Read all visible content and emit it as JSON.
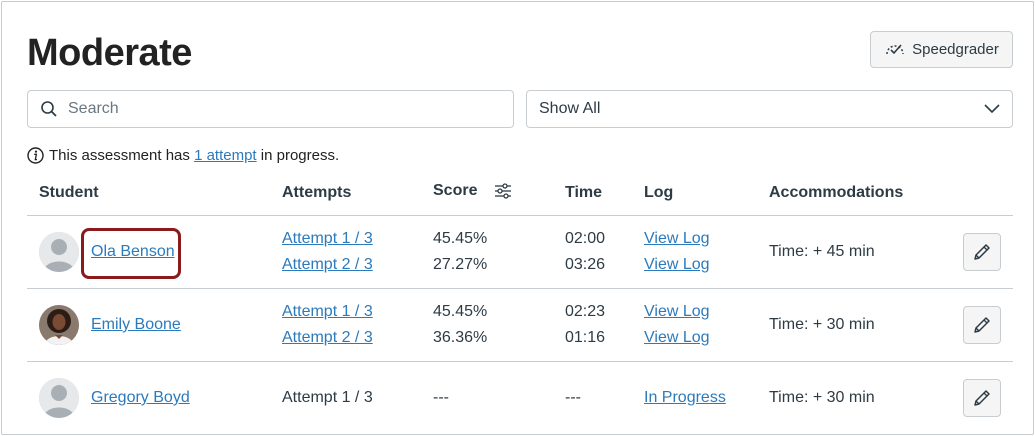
{
  "page": {
    "title": "Moderate",
    "speedgrader_label": "Speedgrader"
  },
  "search": {
    "placeholder": "Search",
    "value": ""
  },
  "filter": {
    "selected": "Show All"
  },
  "notice": {
    "prefix": "This assessment has",
    "link": "1 attempt",
    "suffix": "in progress."
  },
  "table": {
    "headers": {
      "student": "Student",
      "attempts": "Attempts",
      "score": "Score",
      "time": "Time",
      "log": "Log",
      "accommodations": "Accommodations"
    },
    "rows": [
      {
        "name": "Ola Benson",
        "attempts": [
          "Attempt 1 / 3",
          "Attempt 2 / 3"
        ],
        "scores": [
          "45.45%",
          "27.27%"
        ],
        "times": [
          "02:00",
          "03:26"
        ],
        "logs": [
          "View Log",
          "View Log"
        ],
        "accommodation": "Time: + 45 min"
      },
      {
        "name": "Emily Boone",
        "attempts": [
          "Attempt 1 / 3",
          "Attempt 2 / 3"
        ],
        "scores": [
          "45.45%",
          "36.36%"
        ],
        "times": [
          "02:23",
          "01:16"
        ],
        "logs": [
          "View Log",
          "View Log"
        ],
        "accommodation": "Time: + 30 min"
      },
      {
        "name": "Gregory Boyd",
        "attempts": [
          "Attempt 1 / 3"
        ],
        "scores": [
          "---"
        ],
        "times": [
          "---"
        ],
        "logs": [
          "In Progress"
        ],
        "accommodation": "Time: + 30 min"
      }
    ]
  },
  "colors": {
    "link": "#2b7abc",
    "border": "#c7cdd1",
    "highlight": "#8b1a1a",
    "text": "#2d3b45"
  }
}
